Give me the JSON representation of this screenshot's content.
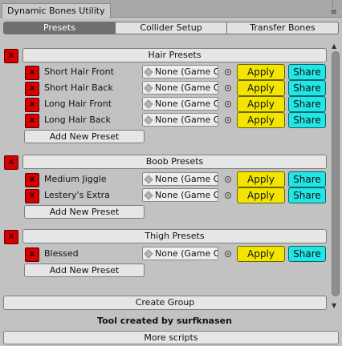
{
  "window": {
    "title": "Dynamic Bones Utility",
    "icons": [
      "kebab-menu-icon",
      "hamburger-menu-icon"
    ]
  },
  "tabs": [
    {
      "label": "Presets",
      "active": true
    },
    {
      "label": "Collider Setup",
      "active": false
    },
    {
      "label": "Transfer Bones",
      "active": false
    }
  ],
  "groups": [
    {
      "name": "Hair Presets",
      "delete_label": "X",
      "presets": [
        {
          "name": "Short Hair Front",
          "object_field": "None (Game Object)",
          "delete_label": "X",
          "apply_label": "Apply",
          "share_label": "Share"
        },
        {
          "name": "Short Hair Back",
          "object_field": "None (Game Object)",
          "delete_label": "X",
          "apply_label": "Apply",
          "share_label": "Share"
        },
        {
          "name": "Long Hair Front",
          "object_field": "None (Game Object)",
          "delete_label": "X",
          "apply_label": "Apply",
          "share_label": "Share"
        },
        {
          "name": "Long Hair Back",
          "object_field": "None (Game Object)",
          "delete_label": "X",
          "apply_label": "Apply",
          "share_label": "Share"
        }
      ],
      "add_label": "Add New Preset"
    },
    {
      "name": "Boob Presets",
      "delete_label": "X",
      "presets": [
        {
          "name": "Medium Jiggle",
          "object_field": "None (Game Object)",
          "delete_label": "X",
          "apply_label": "Apply",
          "share_label": "Share"
        },
        {
          "name": "Lestery's Extra",
          "object_field": "None (Game Object)",
          "delete_label": "X",
          "apply_label": "Apply",
          "share_label": "Share"
        }
      ],
      "add_label": "Add New Preset"
    },
    {
      "name": "Thigh Presets",
      "delete_label": "X",
      "presets": [
        {
          "name": "Blessed",
          "object_field": "None (Game Object)",
          "delete_label": "X",
          "apply_label": "Apply",
          "share_label": "Share"
        }
      ],
      "add_label": "Add New Preset"
    }
  ],
  "footer": {
    "create_group_label": "Create Group",
    "credit": "Tool created by surfknasen",
    "more_scripts_label": "More scripts"
  },
  "colors": {
    "delete": "#d60000",
    "apply": "#f3e500",
    "share": "#22e5e5",
    "active_tab": "#6f6f6f"
  }
}
